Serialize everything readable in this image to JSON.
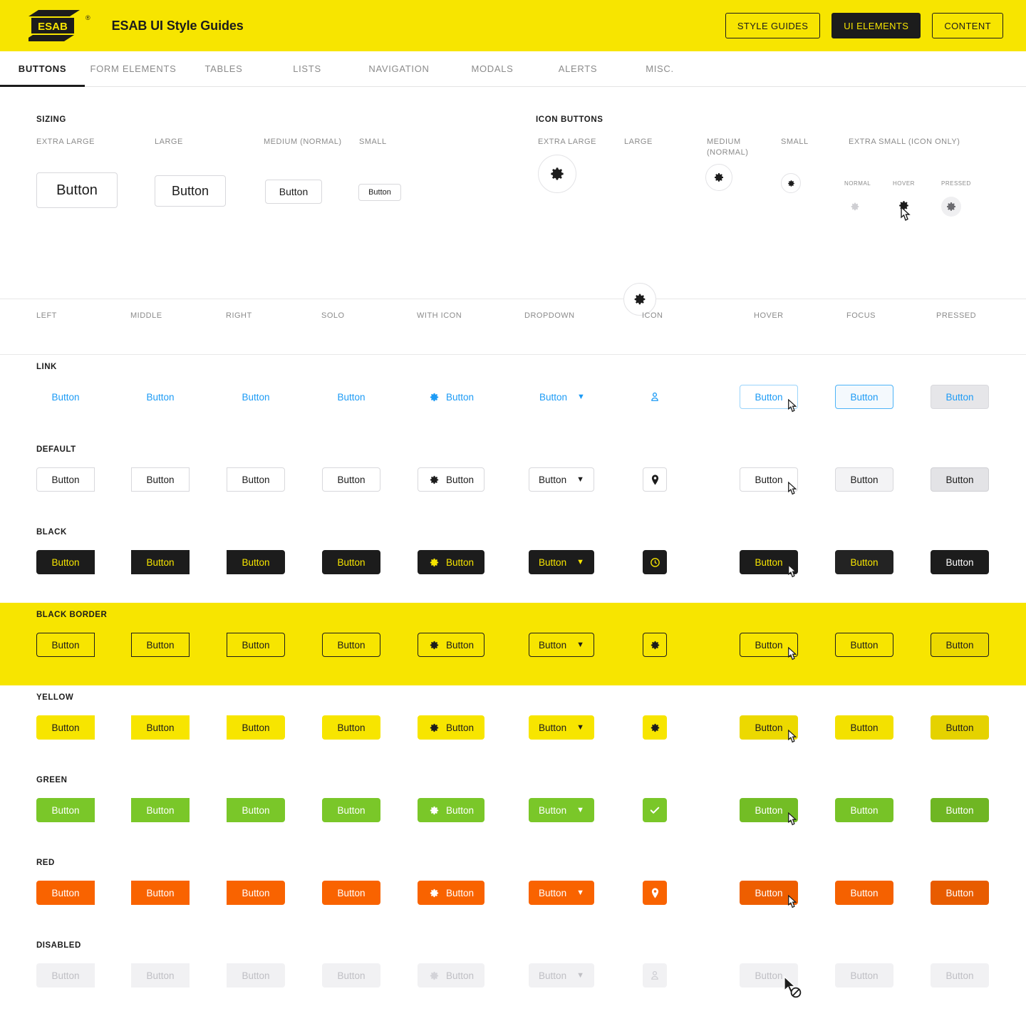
{
  "header": {
    "logo_text": "ESAB",
    "logo_reg": "®",
    "title": "ESAB UI Style Guides",
    "buttons": [
      {
        "label": "STYLE GUIDES",
        "active": false
      },
      {
        "label": "UI ELEMENTS",
        "active": true
      },
      {
        "label": "CONTENT",
        "active": false
      }
    ]
  },
  "tabs": [
    {
      "label": "BUTTONS",
      "selected": true
    },
    {
      "label": "FORM ELEMENTS",
      "selected": false
    },
    {
      "label": "TABLES",
      "selected": false
    },
    {
      "label": "LISTS",
      "selected": false
    },
    {
      "label": "NAVIGATION",
      "selected": false
    },
    {
      "label": "MODALS",
      "selected": false
    },
    {
      "label": "ALERTS",
      "selected": false
    },
    {
      "label": "MISC.",
      "selected": false
    }
  ],
  "sizing": {
    "title": "SIZING",
    "labels": [
      "EXTRA LARGE",
      "LARGE",
      "MEDIUM (NORMAL)",
      "SMALL"
    ],
    "button_label": "Button"
  },
  "icon_buttons": {
    "title": "ICON BUTTONS",
    "labels": [
      "EXTRA LARGE",
      "LARGE",
      "MEDIUM (NORMAL)",
      "SMALL",
      "EXTRA SMALL (ICON ONLY)"
    ],
    "state_labels": [
      "NORMAL",
      "HOVER",
      "PRESSED"
    ],
    "icon": "gear-icon"
  },
  "grid": {
    "columns": [
      "LEFT",
      "MIDDLE",
      "RIGHT",
      "SOLO",
      "WITH ICON",
      "DROPDOWN",
      "ICON",
      "HOVER",
      "FOCUS",
      "PRESSED"
    ],
    "button_label": "Button",
    "rows": [
      {
        "label": "LINK",
        "icon": "user-icon",
        "banded": false
      },
      {
        "label": "DEFAULT",
        "icon": "location-icon",
        "banded": false
      },
      {
        "label": "BLACK",
        "icon": "clock-icon",
        "banded": false
      },
      {
        "label": "BLACK BORDER",
        "icon": "gear-icon",
        "banded": true
      },
      {
        "label": "YELLOW",
        "icon": "gear-icon",
        "banded": false
      },
      {
        "label": "GREEN",
        "icon": "check-icon",
        "banded": false
      },
      {
        "label": "RED",
        "icon": "location-icon",
        "banded": false
      },
      {
        "label": "DISABLED",
        "icon": "user-icon",
        "banded": false
      }
    ]
  },
  "colors": {
    "brand_yellow": "#f7e500",
    "black": "#1c1c1c",
    "link_blue": "#1d9bf5",
    "green": "#7ac729",
    "red": "#f96300",
    "disabled_bg": "#f1f1f3",
    "disabled_text": "#bfbfc4",
    "border_grey": "#d8d8dc"
  }
}
